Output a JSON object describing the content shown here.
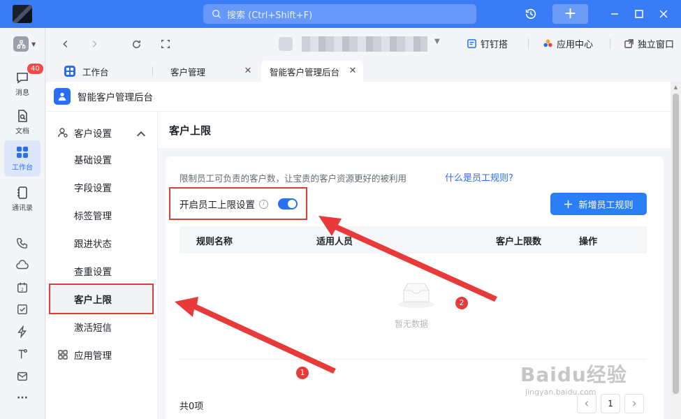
{
  "titlebar": {
    "search_placeholder": "搜索 (Ctrl+Shift+F)",
    "new_label": "+"
  },
  "rail": {
    "messages_label": "消息",
    "messages_badge": "40",
    "docs_label": "文档",
    "workbench_label": "工作台",
    "contacts_label": "通讯录"
  },
  "browser": {
    "dingdingda_label": "钉钉搭",
    "app_center_label": "应用中心",
    "standalone_label": "独立窗口"
  },
  "tabs": [
    {
      "label": "工作台"
    },
    {
      "label": "客户管理"
    },
    {
      "label": "智能客户管理后台"
    }
  ],
  "app": {
    "title": "智能客户管理后台"
  },
  "menu": {
    "group_customer_settings": "客户设置",
    "items": [
      "基础设置",
      "字段设置",
      "标签管理",
      "跟进状态",
      "查重设置",
      "客户上限",
      "激活短信"
    ],
    "group_app_management": "应用管理"
  },
  "page": {
    "title": "客户上限",
    "description": "限制员工可负责的客户数，让宝贵的客户资源更好的被利用",
    "help_link": "什么是员工规则?",
    "toggle_label": "开启员工上限设置",
    "add_button": "新增员工规则",
    "columns": [
      "规则名称",
      "适用人员",
      "客户上限数",
      "操作"
    ],
    "empty_text": "暂无数据",
    "total": "共0项",
    "page_number": "1"
  },
  "annotations": {
    "marker_1": "1",
    "marker_2": "2",
    "highlight_color": "#e03a3a"
  },
  "watermark": {
    "brand": "Baidu经验",
    "url": "jingyan.baidu.com"
  }
}
